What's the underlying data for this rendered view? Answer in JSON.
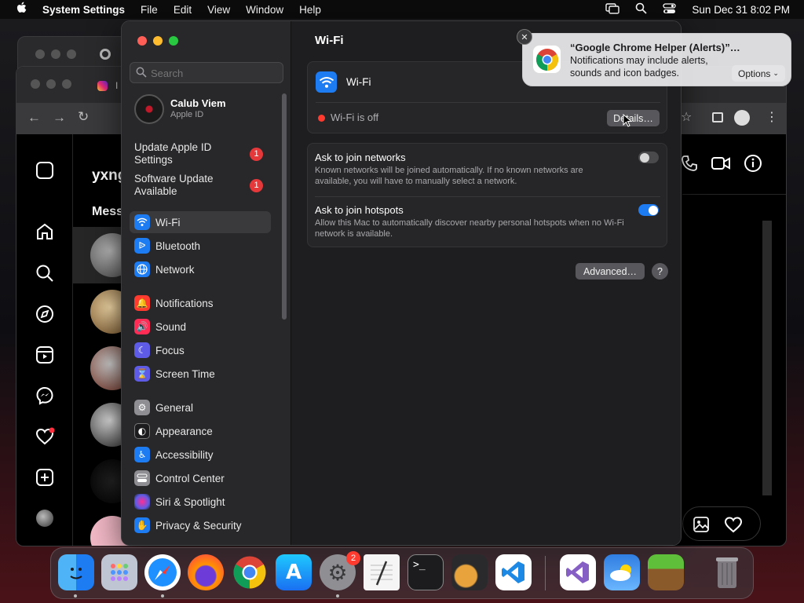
{
  "menubar": {
    "apple_icon": "apple-logo",
    "app_name": "System Settings",
    "menus": [
      "File",
      "Edit",
      "View",
      "Window",
      "Help"
    ],
    "clock": "Sun Dec 31  8:02 PM"
  },
  "instagram": {
    "tab_label": "I",
    "chat_title": "yxng",
    "messages_heading": "Mess"
  },
  "settings": {
    "search_placeholder": "Search",
    "account": {
      "name": "Calub Viem",
      "subtitle": "Apple ID"
    },
    "alerts": [
      {
        "label": "Update Apple ID Settings",
        "count": "1"
      },
      {
        "label": "Software Update Available",
        "count": "1"
      }
    ],
    "sidebar": [
      {
        "label": "Wi-Fi",
        "icon": "wifi-icon",
        "color": "#1e7cf2",
        "selected": true
      },
      {
        "label": "Bluetooth",
        "icon": "bluetooth-icon",
        "color": "#1e7cf2"
      },
      {
        "label": "Network",
        "icon": "globe-icon",
        "color": "#1e7cf2"
      },
      {
        "label": "Notifications",
        "icon": "bell-icon",
        "color": "#ff3b30"
      },
      {
        "label": "Sound",
        "icon": "speaker-icon",
        "color": "#ff2d55"
      },
      {
        "label": "Focus",
        "icon": "moon-icon",
        "color": "#5e5ce6"
      },
      {
        "label": "Screen Time",
        "icon": "hourglass-icon",
        "color": "#5e5ce6"
      },
      {
        "label": "General",
        "icon": "gear-icon",
        "color": "#8e8e93"
      },
      {
        "label": "Appearance",
        "icon": "appearance-icon",
        "color": "#1c1c1e"
      },
      {
        "label": "Accessibility",
        "icon": "accessibility-icon",
        "color": "#1e7cf2"
      },
      {
        "label": "Control Center",
        "icon": "control-center-icon",
        "color": "#8e8e93"
      },
      {
        "label": "Siri & Spotlight",
        "icon": "siri-icon",
        "color": "#bf5af2"
      },
      {
        "label": "Privacy & Security",
        "icon": "hand-icon",
        "color": "#1e7cf2"
      }
    ],
    "page_title": "Wi-Fi",
    "wifi_label": "Wi-Fi",
    "wifi_status": "Wi-Fi is off",
    "details_button": "Details…",
    "ask_networks": {
      "title": "Ask to join networks",
      "desc": "Known networks will be joined automatically. If no known networks are available, you will have to manually select a network.",
      "enabled": false
    },
    "ask_hotspots": {
      "title": "Ask to join hotspots",
      "desc": "Allow this Mac to automatically discover nearby personal hotspots when no Wi-Fi network is available.",
      "enabled": true
    },
    "advanced_button": "Advanced…",
    "help_button": "?"
  },
  "notification": {
    "title": "“Google Chrome Helper (Alerts)”…",
    "body": "Notifications may include alerts, sounds and icon badges.",
    "options_label": "Options"
  },
  "dock": {
    "apps": [
      "Finder",
      "Launchpad",
      "Safari",
      "Firefox",
      "Google Chrome",
      "App Store",
      "System Settings",
      "TextEdit",
      "Terminal",
      "GarageBand",
      "Visual Studio Code",
      "Visual Studio",
      "Weather",
      "Minecraft",
      "Trash"
    ],
    "settings_badge": "2"
  }
}
